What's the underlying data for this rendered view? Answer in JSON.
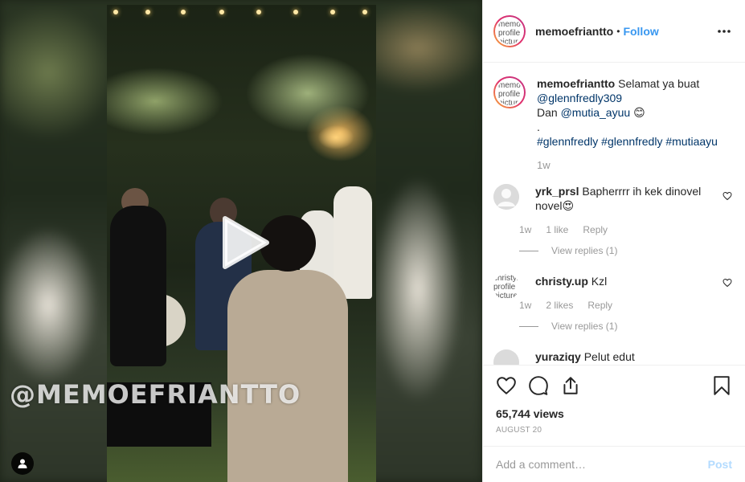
{
  "media": {
    "watermark": "@MEMOEFRIANTTO",
    "icons": {
      "play": "play-icon",
      "user_tag": "user-tag-icon"
    }
  },
  "header": {
    "avatar_alt": "memoefriantto's profile picture",
    "username": "memoefriantto",
    "separator": "•",
    "follow_label": "Follow",
    "more_icon": "more-options-icon"
  },
  "caption": {
    "avatar_alt": "memoefriantto's profile picture",
    "username": "memoefriantto",
    "text_1": "Selamat ya buat",
    "mention_1": "@glennfredly309",
    "text_2": "Dan",
    "mention_2": "@mutia_ayuu",
    "emoji": "😊",
    "dot": ".",
    "hashtag_1": "#glennfredly",
    "hashtag_2": "#glennfredly",
    "hashtag_3": "#mutiaayu",
    "time": "1w"
  },
  "comments": [
    {
      "username": "yrk_prsl",
      "text": "Bapherrrr ih kek dinovel novel",
      "emoji": "😍",
      "time": "1w",
      "likes": "1 like",
      "reply_label": "Reply",
      "view_replies": "View replies (1)"
    },
    {
      "avatar_alt": "christy.up's profile picture",
      "username": "christy.up",
      "text": "Kzl",
      "time": "1w",
      "likes": "2 likes",
      "reply_label": "Reply",
      "view_replies": "View replies (1)"
    },
    {
      "username": "yuraziqy",
      "text": "Pelut edut"
    }
  ],
  "actions": {
    "icons": [
      "heart-icon",
      "comment-icon",
      "share-icon",
      "bookmark-icon"
    ]
  },
  "stats": {
    "views": "65,744 views",
    "date": "AUGUST 20"
  },
  "add_comment": {
    "placeholder": "Add a comment…",
    "post_label": "Post"
  }
}
